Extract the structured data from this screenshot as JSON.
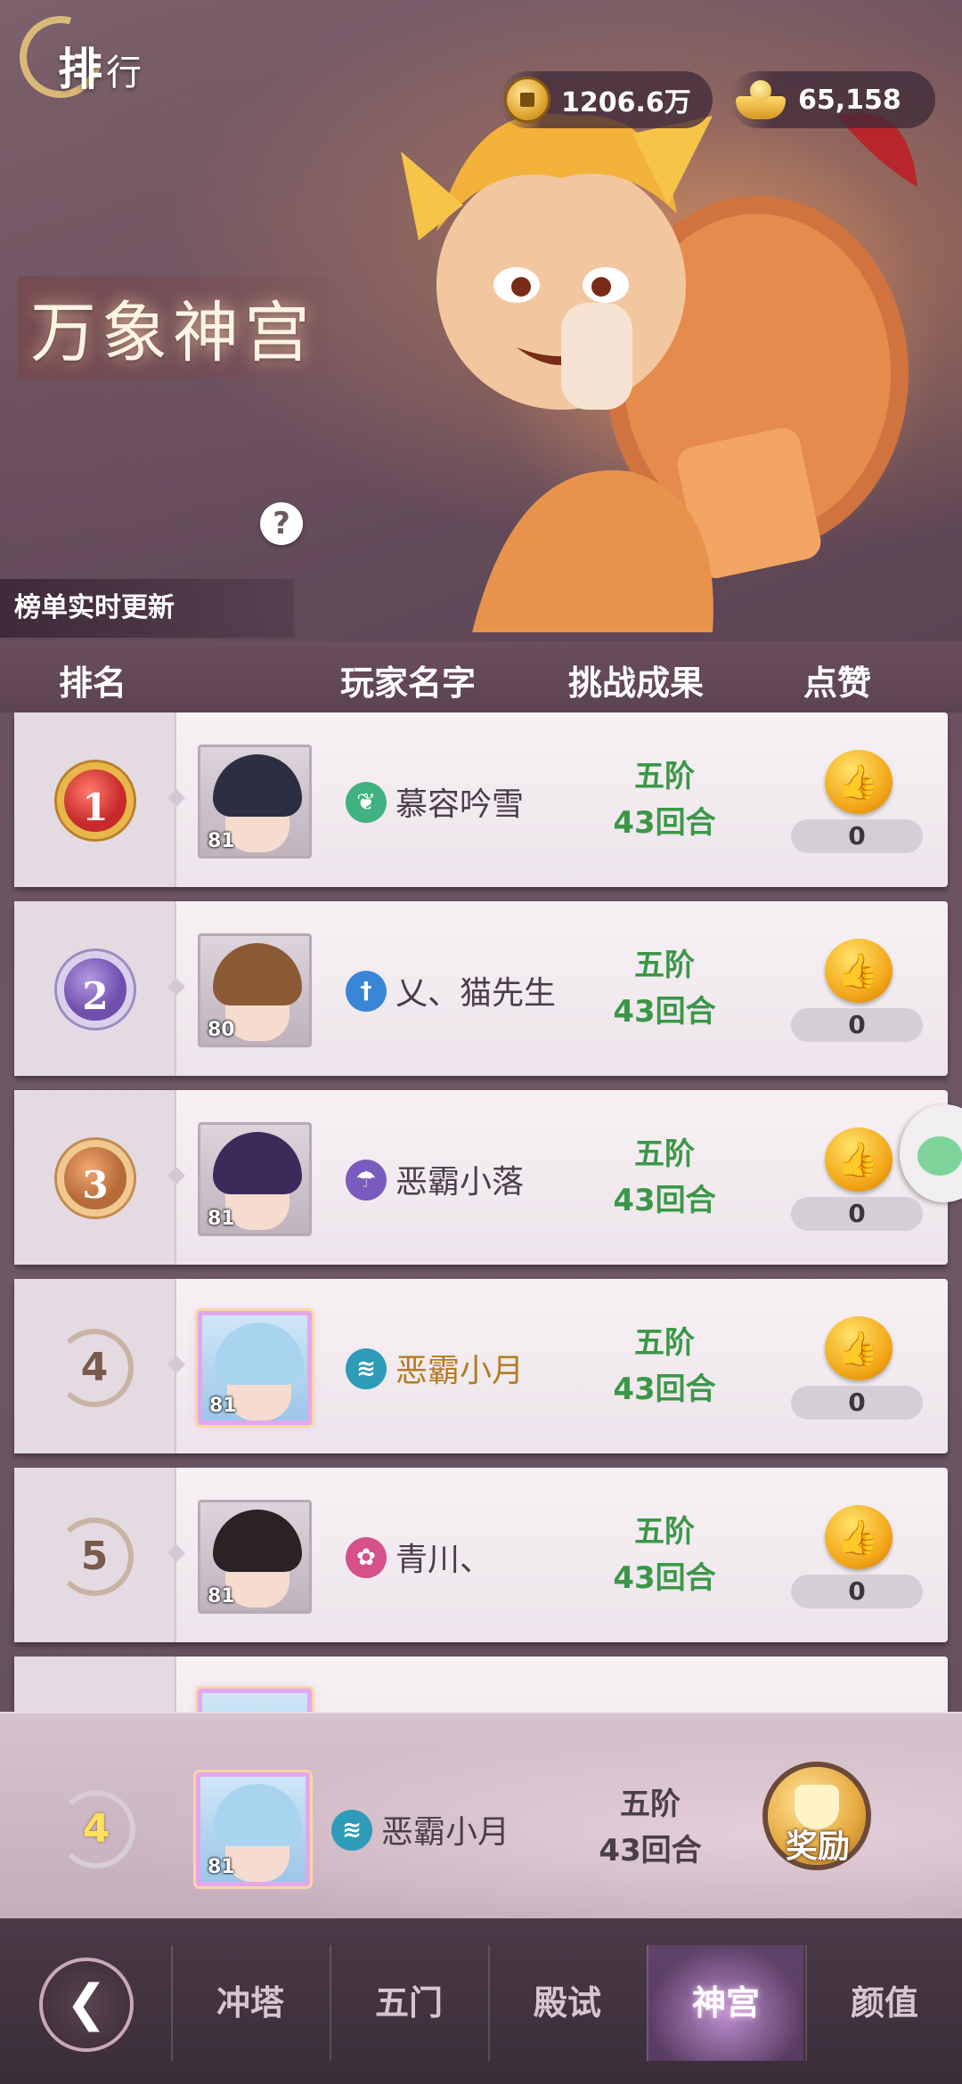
{
  "header": {
    "rank_title_main": "排",
    "rank_title_sub": "行",
    "coins": "1206.6万",
    "ingots": "65,158",
    "palace_title": "万象神宫",
    "help_symbol": "?",
    "update_note": "榜单实时更新"
  },
  "columns": {
    "rank": "排名",
    "name": "玩家名字",
    "result": "挑战成果",
    "like": "点赞"
  },
  "rows": [
    {
      "rank": "1",
      "level": "81",
      "name": "慕容吟雪",
      "school_icon": "leaf-icon",
      "school_color": "#3fb27f",
      "tier": "五阶",
      "rounds": "43回合",
      "likes": "0"
    },
    {
      "rank": "2",
      "level": "80",
      "name": "乂、猫先生",
      "school_icon": "sword-icon",
      "school_color": "#3a86d6",
      "tier": "五阶",
      "rounds": "43回合",
      "likes": "0"
    },
    {
      "rank": "3",
      "level": "81",
      "name": "恶霸小落",
      "school_icon": "umbrella-icon",
      "school_color": "#7a5bbf",
      "tier": "五阶",
      "rounds": "43回合",
      "likes": "0"
    },
    {
      "rank": "4",
      "level": "81",
      "name": "恶霸小月",
      "school_icon": "wave-icon",
      "school_color": "#2e9bb8",
      "tier": "五阶",
      "rounds": "43回合",
      "likes": "0"
    },
    {
      "rank": "5",
      "level": "81",
      "name": "青川、",
      "school_icon": "flower-icon",
      "school_color": "#d6508a",
      "tier": "五阶",
      "rounds": "43回合",
      "likes": "0"
    }
  ],
  "my_rank": {
    "rank": "4",
    "level": "81",
    "name": "恶霸小月",
    "tier": "五阶",
    "rounds": "43回合",
    "reward_label": "奖励"
  },
  "nav": {
    "back_symbol": "❮",
    "tabs": [
      "冲塔",
      "五门",
      "殿试",
      "神宫",
      "颜值"
    ],
    "active": "神宫"
  },
  "icons": {
    "like": "thumbs-up-icon",
    "coin": "coin-icon",
    "ingot": "ingot-icon"
  }
}
